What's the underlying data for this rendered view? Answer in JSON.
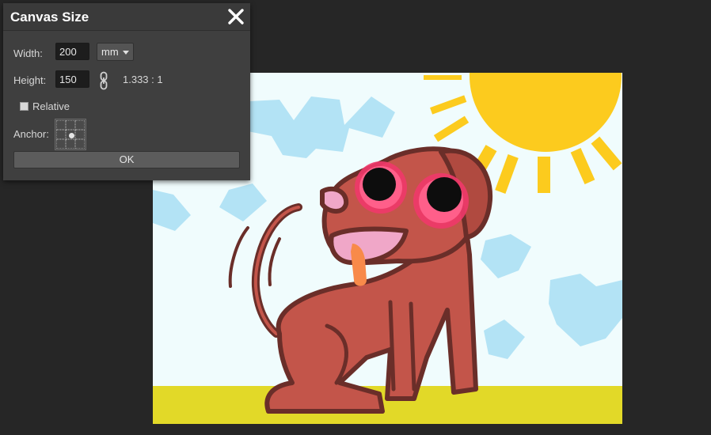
{
  "dialog": {
    "title": "Canvas Size",
    "close_icon": "close-icon",
    "width_label": "Width:",
    "width_value": "200",
    "unit_value": "mm",
    "height_label": "Height:",
    "height_value": "150",
    "link_icon": "chain-link-icon",
    "ratio_text": "1.333 : 1",
    "relative_label": "Relative",
    "relative_checked": false,
    "anchor_label": "Anchor:",
    "anchor_selected": "center",
    "ok_label": "OK"
  },
  "canvas": {
    "artwork": "cartoon dog with googly eyes under a sun",
    "background_color": "#f0fcfd",
    "ground_color": "#e2d928",
    "sun_color": "#fccb1e",
    "dog_color": "#c3554a",
    "eye_ring_color": "#f0386a"
  }
}
